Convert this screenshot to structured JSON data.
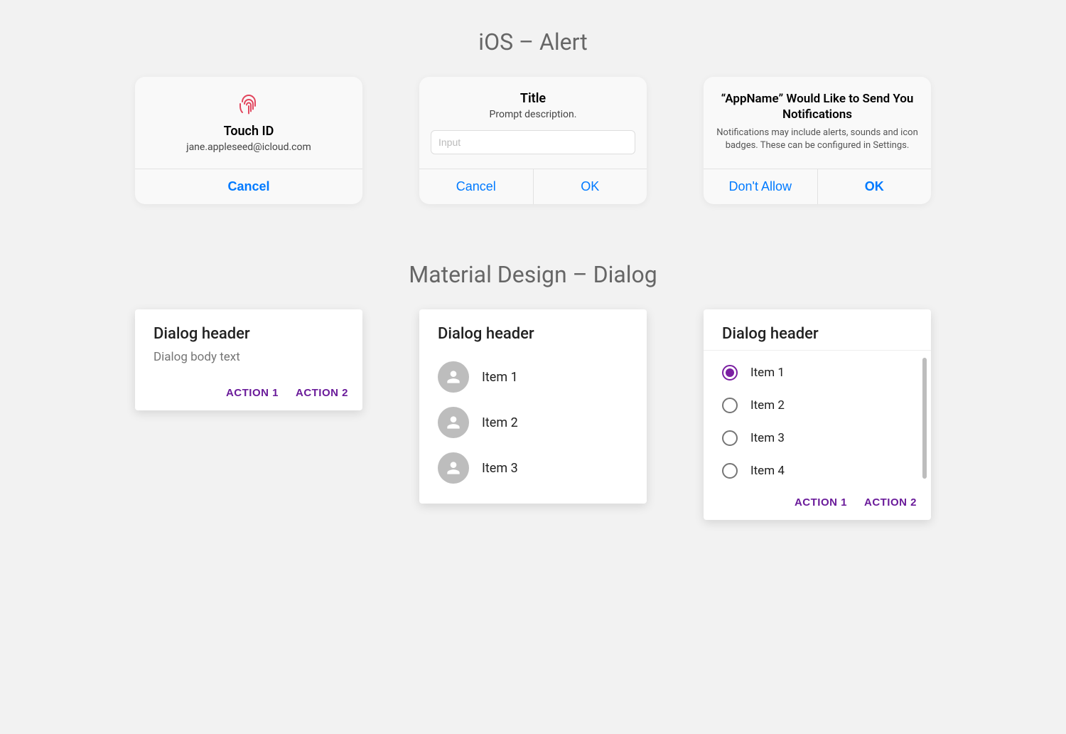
{
  "sections": {
    "ios_title": "iOS – Alert",
    "material_title": "Material Design – Dialog"
  },
  "ios": {
    "touchid": {
      "title": "Touch ID",
      "subtitle": "jane.appleseed@icloud.com",
      "cancel": "Cancel"
    },
    "prompt": {
      "title": "Title",
      "body": "Prompt description.",
      "placeholder": "Input",
      "cancel": "Cancel",
      "ok": "OK"
    },
    "notify": {
      "title": "“AppName” Would Like to Send You Notifications",
      "body": "Notifications may include alerts, sounds and icon badges. These can be configured in Settings.",
      "deny": "Don't Allow",
      "allow": "OK"
    }
  },
  "material": {
    "simple": {
      "header": "Dialog header",
      "body": "Dialog body text",
      "action1": "ACTION 1",
      "action2": "ACTION 2"
    },
    "list": {
      "header": "Dialog header",
      "items": [
        "Item 1",
        "Item 2",
        "Item 3"
      ]
    },
    "radio": {
      "header": "Dialog header",
      "items": [
        "Item 1",
        "Item 2",
        "Item 3",
        "Item 4"
      ],
      "selected_index": 0,
      "action1": "ACTION 1",
      "action2": "ACTION 2"
    }
  }
}
